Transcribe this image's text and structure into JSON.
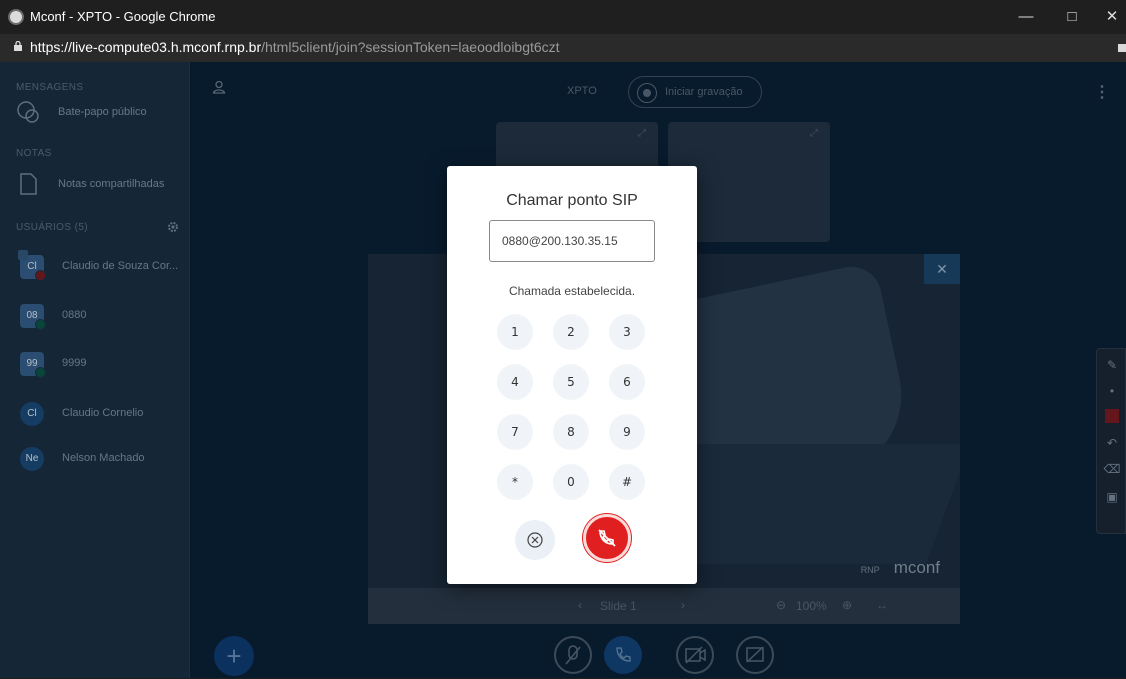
{
  "browser": {
    "window_title": "Mconf - XPTO - Google Chrome",
    "url_host": "https://live-compute03.h.mconf.rnp.br",
    "url_path": "/html5client/join?sessionToken=laeoodloibgt6czt"
  },
  "sidebar": {
    "messages_label": "MENSAGENS",
    "public_chat": "Bate-papo público",
    "notes_label": "NOTAS",
    "shared_notes": "Notas compartilhadas",
    "users_label": "USUÁRIOS (5)",
    "users": [
      {
        "initials": "Cl",
        "name": "Claudio de Souza Cor...",
        "color": "#345f8a"
      },
      {
        "initials": "08",
        "name": "0880",
        "color": "#345f8a"
      },
      {
        "initials": "99",
        "name": "9999",
        "color": "#345f8a"
      },
      {
        "initials": "Cl",
        "name": "Claudio Cornelio",
        "color": "#1a4a78"
      },
      {
        "initials": "Ne",
        "name": "Nelson Machado",
        "color": "#1a4a78"
      }
    ]
  },
  "topbar": {
    "meeting_name": "XPTO",
    "record_label": "Iniciar gravação"
  },
  "presentation": {
    "brand": "mconf",
    "rnp": "RNP",
    "slide_label": "Slide 1",
    "zoom": "100%"
  },
  "modal": {
    "title": "Chamar ponto SIP",
    "sip_value": "0880@200.130.35.15",
    "status": "Chamada estabelecida.",
    "keys": [
      "1",
      "2",
      "3",
      "4",
      "5",
      "6",
      "7",
      "8",
      "9",
      "*",
      "0",
      "#"
    ]
  },
  "colors": {
    "hangup": "#e02020",
    "accent": "#12447a"
  }
}
